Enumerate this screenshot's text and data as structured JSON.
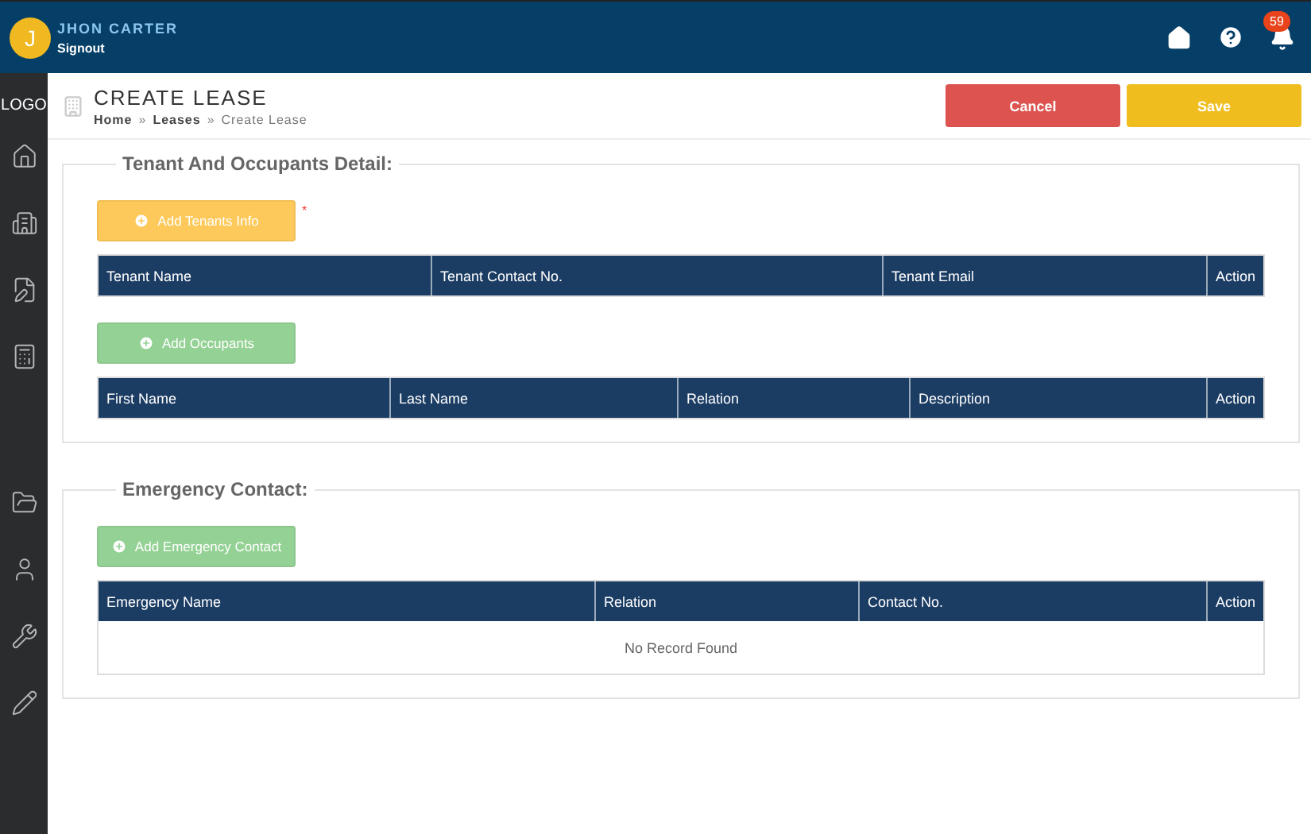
{
  "header": {
    "avatar_letter": "J",
    "user_name": "JHON CARTER",
    "signout": "Signout",
    "notification_count": "59"
  },
  "sidebar": {
    "logo": "LOGO"
  },
  "page": {
    "title": "CREATE LEASE",
    "breadcrumb": [
      {
        "label": "Home",
        "current": false
      },
      {
        "label": "Leases",
        "current": false
      },
      {
        "label": "Create Lease",
        "current": true
      }
    ],
    "breadcrumb_separator": "»"
  },
  "actions": [
    {
      "kind": "cancel",
      "label": "Cancel"
    },
    {
      "kind": "save",
      "label": "Save"
    }
  ],
  "sections": [
    {
      "title": "Tenant And Occupants Detail:",
      "blocks": [
        {
          "button": {
            "label": "Add Tenants Info",
            "kind": "primary",
            "required_mark": "*"
          },
          "table": {
            "columns": [
              "Tenant Name",
              "Tenant Contact No.",
              "Tenant Email",
              "Action"
            ]
          }
        },
        {
          "button": {
            "label": "Add Occupants",
            "kind": "success"
          },
          "table": {
            "columns": [
              "First Name",
              "Last Name",
              "Relation",
              "Description",
              "Action"
            ]
          }
        }
      ]
    },
    {
      "title": "Emergency Contact:",
      "blocks": [
        {
          "button": {
            "label": "Add Emergency Contact",
            "kind": "success"
          },
          "table": {
            "columns": [
              "Emergency Name",
              "Relation",
              "Contact No.",
              "Action"
            ],
            "empty_message": "No Record Found"
          }
        }
      ]
    }
  ]
}
